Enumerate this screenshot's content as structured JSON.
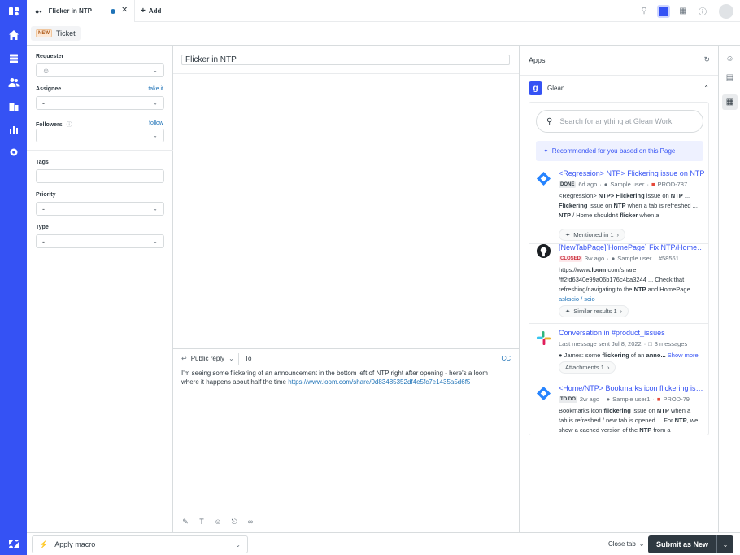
{
  "colors": {
    "nav_bg": "#3552f4",
    "link": "#1f73b7",
    "glean_blue": "#3552f4",
    "submit_bg": "#2f3941"
  },
  "nav": {
    "icons": [
      "zendesk-logo-icon",
      "home-icon",
      "views-icon",
      "customers-icon",
      "organizations-icon",
      "reporting-icon",
      "admin-gear-icon",
      "zendesk-products-icon"
    ]
  },
  "tabs": [
    {
      "label": "Flicker in NTP"
    }
  ],
  "add_tab_label": "Add",
  "subheader": {
    "badge": "NEW",
    "label": "Ticket"
  },
  "properties": {
    "requester_label": "Requester",
    "assignee_label": "Assignee",
    "assignee_link": "take it",
    "assignee_value": "-",
    "followers_label": "Followers",
    "followers_link": "follow",
    "tags_label": "Tags",
    "priority_label": "Priority",
    "priority_value": "-",
    "type_label": "Type",
    "type_value": "-"
  },
  "ticket": {
    "subject": "Flicker in NTP",
    "reply_type": "Public reply",
    "to_label": "To",
    "cc_label": "CC",
    "body": "I'm seeing some flickering of an announcement in the bottom left of NTP right after opening - here's a loom where it happens about half the time ",
    "body_link": "https://www.loom.com/share/0d83485352df4e5fc7e1435a5d6f5"
  },
  "apps": {
    "title": "Apps",
    "glean_name": "Glean",
    "search_placeholder": "Search for anything at Glean Work",
    "recommended_label": "Recommended for you based on this Page",
    "results": [
      {
        "title": "<Regression> NTP> Flickering issue on NTP",
        "status": "DONE",
        "time": "6d ago",
        "user": "Sample user",
        "ref": "PROD-787",
        "chip": "Mentioned in 1",
        "icon": "jira-icon"
      },
      {
        "title": "[NewTabPage][HomePage] Fix NTP/HomePage",
        "status": "CLOSED",
        "time": "3w ago",
        "user": "Sample user",
        "ref": "#58561",
        "path_a": "askscio",
        "path_sep": "/",
        "path_b": "scio",
        "chip": "Similar results 1",
        "icon": "github-icon"
      },
      {
        "title": "Conversation in #product_issues",
        "meta": "Last message sent Jul 8, 2022",
        "messages": "3 messages",
        "user_prefix": "James:",
        "show_more": "Show more",
        "chip": "Attachments 1",
        "icon": "slack-icon"
      },
      {
        "title": "<Home/NTP> Bookmarks icon flickering issue",
        "status": "TO DO",
        "time": "2w ago",
        "user": "Sample user1",
        "ref": "PROD-79",
        "icon": "jira-icon"
      }
    ]
  },
  "bottom": {
    "macro_label": "Apply macro",
    "close_tab_label": "Close tab",
    "submit_label": "Submit as New"
  }
}
